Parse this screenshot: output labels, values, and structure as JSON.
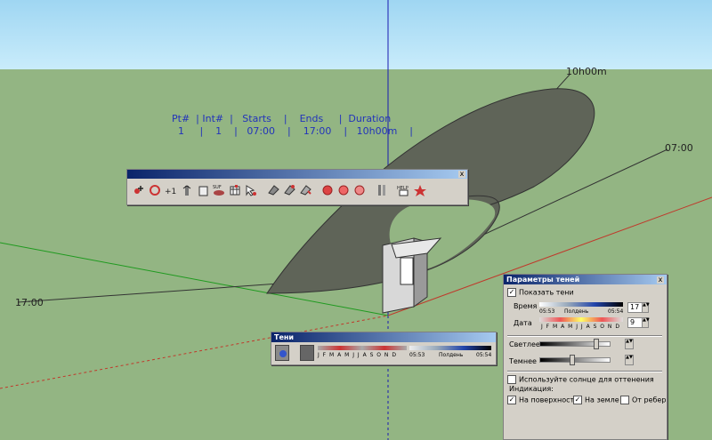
{
  "viewport": {
    "time_label_top": "10h00m",
    "time_label_right": "07:00",
    "time_label_left": "17:00"
  },
  "stats": {
    "header": "Pt#  | Int#  |   Starts    |    Ends     |  Duration",
    "row": "  1     |    1    |   07:00    |    17:00    |   10h00m    |"
  },
  "toolbar": {
    "close": "x",
    "icons": [
      "add-point-icon",
      "cycle-icon",
      "plus-one-icon",
      "measure-icon",
      "paste-icon",
      "suf-icon",
      "table-icon",
      "select-arrow-icon",
      "shade-icon-1",
      "shade-icon-2",
      "shade-icon-3",
      "sun-red-icon-1",
      "sun-red-icon-2",
      "sun-red-icon-3",
      "tools-icon",
      "help-icon",
      "star-icon"
    ],
    "suf_label": "SUF",
    "help_label": "HELP"
  },
  "shadows_bar": {
    "title": "Тени",
    "months": "J F M A M J J A S O N D",
    "time_start": "05:53",
    "noon": "Полдень",
    "time_end": "05:54"
  },
  "shadow_settings": {
    "title": "Параметры теней",
    "close": "x",
    "show_shadows": "Показать тени",
    "time_label": "Время",
    "time_start": "05:53",
    "noon": "Полдень",
    "time_end": "05:54",
    "time_value": "17",
    "date_label": "Дата",
    "months": "J F M A M J J A S O N D",
    "date_value": "9",
    "lighter": "Светлее",
    "darker": "Темнее",
    "use_sun": "Используйте солнце для оттенения",
    "display": "Индикация:",
    "on_faces": "На поверхности",
    "on_ground": "На земле",
    "from_edges": "От ребер"
  }
}
